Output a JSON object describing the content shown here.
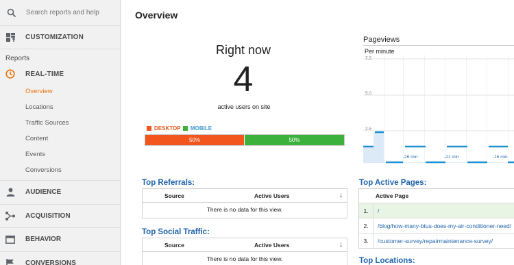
{
  "sidebar": {
    "search_placeholder": "Search reports and help",
    "customization": "CUSTOMIZATION",
    "reports_label": "Reports",
    "realtime": "REAL-TIME",
    "realtime_items": [
      "Overview",
      "Locations",
      "Traffic Sources",
      "Content",
      "Events",
      "Conversions"
    ],
    "audience": "AUDIENCE",
    "acquisition": "ACQUISITION",
    "behavior": "BEHAVIOR",
    "conversions": "CONVERSIONS"
  },
  "page": {
    "title": "Overview"
  },
  "right_now": {
    "heading": "Right now",
    "count": "4",
    "label": "active users on site",
    "legend_desktop": "DESKTOP",
    "legend_mobile": "MOBILE",
    "desktop_pct": "50%",
    "mobile_pct": "50%",
    "desktop_fraction": 0.5,
    "mobile_fraction": 0.5
  },
  "pageviews": {
    "title": "Pageviews",
    "subtitle": "Per minute",
    "y_ticks": [
      "7.5",
      "5.0",
      "2.5"
    ],
    "x_ticks": [
      "-26 min",
      "-21 min",
      "-16 min"
    ]
  },
  "top_referrals": {
    "title": "Top Referrals:",
    "col_source": "Source",
    "col_users": "Active Users",
    "empty": "There is no data for this view."
  },
  "top_social": {
    "title": "Top Social Traffic:",
    "col_source": "Source",
    "col_users": "Active Users",
    "empty": "There is no data for this view."
  },
  "top_pages": {
    "title": "Top Active Pages:",
    "col_page": "Active Page",
    "rows": [
      {
        "num": "1.",
        "page": "/"
      },
      {
        "num": "2.",
        "page": "/blog/how-many-btus-does-my-air-conditioner-need/"
      },
      {
        "num": "3.",
        "page": "/customer-survey/repairmaintenance-survey/"
      }
    ]
  },
  "top_locations": {
    "title": "Top Locations:"
  },
  "colors": {
    "accent_orange": "#e8710a",
    "desktop": "#f2561d",
    "mobile": "#3cb13b",
    "link_blue": "#1f64ad",
    "chart_blue": "#1a8fd6"
  },
  "icons": {
    "search": "search-icon",
    "customization": "dashboard-icon",
    "realtime": "clock-icon",
    "audience": "person-icon",
    "acquisition": "acquisition-icon",
    "behavior": "behavior-icon",
    "conversions": "flag-icon"
  }
}
